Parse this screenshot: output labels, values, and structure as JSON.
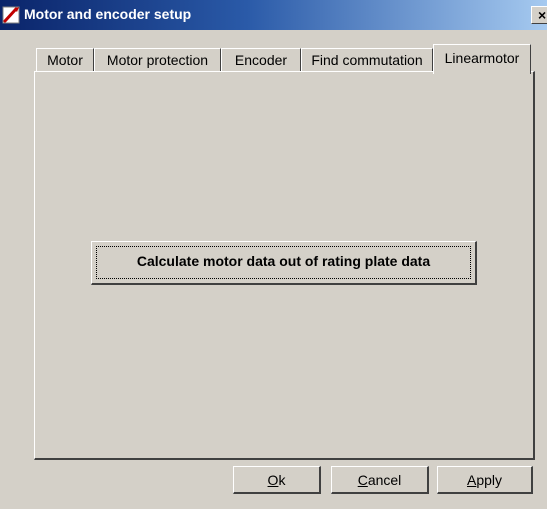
{
  "window": {
    "title": "Motor and encoder setup",
    "close_glyph": "×"
  },
  "tabs": [
    {
      "label": "Motor",
      "active": false
    },
    {
      "label": "Motor protection",
      "active": false
    },
    {
      "label": "Encoder",
      "active": false
    },
    {
      "label": "Find commutation",
      "active": false
    },
    {
      "label": "Linearmotor",
      "active": true
    }
  ],
  "panel": {
    "calc_button_label": "Calculate motor data out of rating plate data"
  },
  "footer": {
    "ok": {
      "mnemonic": "O",
      "rest": "k"
    },
    "cancel": {
      "mnemonic": "C",
      "rest": "ancel"
    },
    "apply": {
      "mnemonic": "A",
      "rest": "pply"
    }
  },
  "icons": {
    "app": "motor-setup-icon",
    "close": "close-icon"
  },
  "colors": {
    "face": "#d4d0c8",
    "title_start": "#0a246a",
    "title_end": "#a6caf0",
    "shadow": "#404040",
    "highlight": "#ffffff"
  }
}
